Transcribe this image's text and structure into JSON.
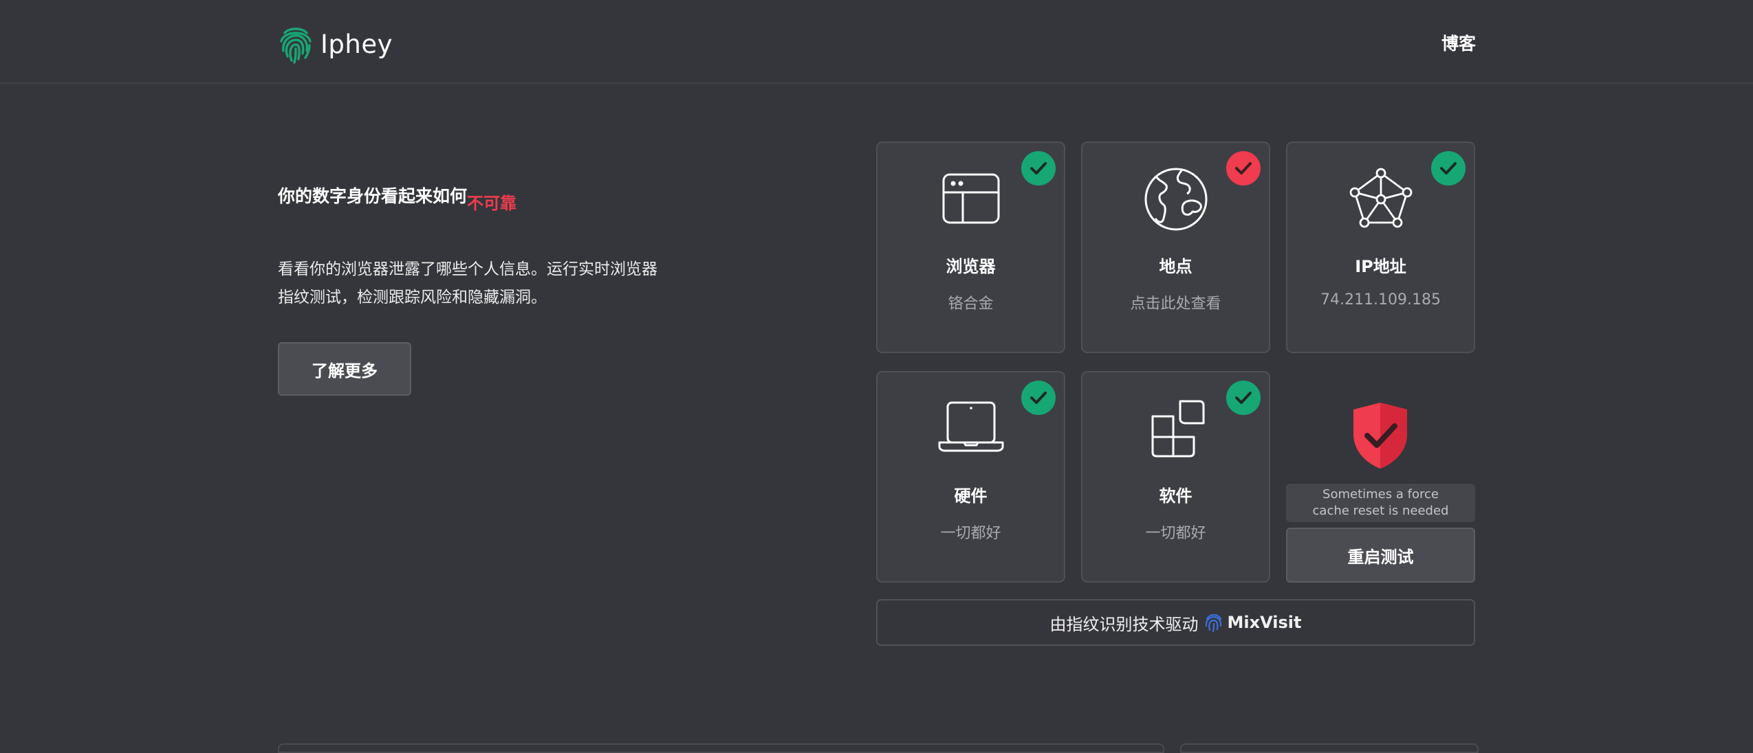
{
  "header": {
    "brand": "Iphey",
    "nav_blog": "博客"
  },
  "hero": {
    "headline": "你的数字身份看起来如何",
    "status": "不可靠",
    "description": "看看你的浏览器泄露了哪些个人信息。运行实时浏览器指纹测试，检测跟踪风险和隐藏漏洞。",
    "learn_more": "了解更多"
  },
  "cards": [
    {
      "title": "浏览器",
      "value": "铬合金",
      "status": "ok",
      "icon": "browser-window-icon"
    },
    {
      "title": "地点",
      "value": "点击此处查看",
      "status": "bad",
      "icon": "globe-icon"
    },
    {
      "title": "IP地址",
      "value": "74.211.109.185",
      "status": "ok",
      "icon": "network-icon"
    },
    {
      "title": "硬件",
      "value": "一切都好",
      "status": "ok",
      "icon": "laptop-icon"
    },
    {
      "title": "软件",
      "value": "一切都好",
      "status": "ok",
      "icon": "software-blocks-icon"
    }
  ],
  "summary": {
    "cache_note_line1": "Sometimes a force",
    "cache_note_line2": "cache reset is needed",
    "restart_button": "重启测试"
  },
  "footer": {
    "powered_by": "由指纹识别技术驱动",
    "powered_brand": "MixVisit"
  },
  "colors": {
    "background": "#35363b",
    "ok": "#17a774",
    "bad": "#ef3c4e",
    "logo": "#17a774",
    "mixvisit": "#3b6fe0"
  }
}
